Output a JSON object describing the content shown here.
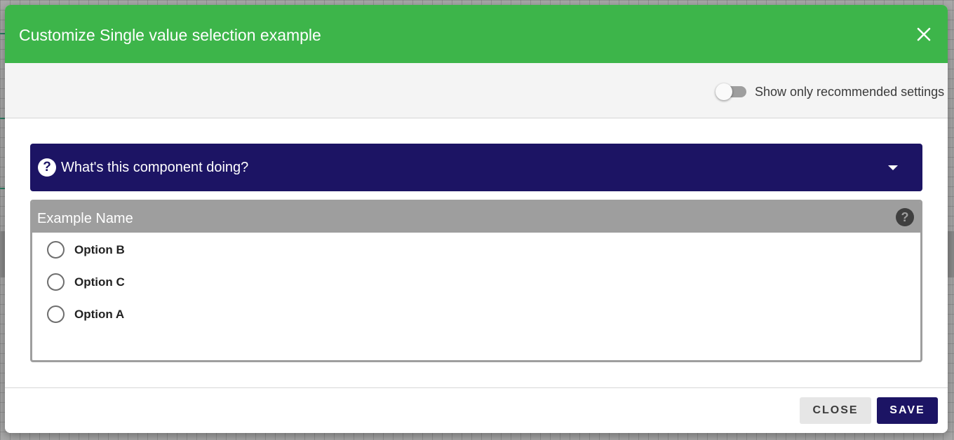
{
  "modal": {
    "title": "Customize Single value selection example"
  },
  "settings": {
    "toggle_label": "Show only recommended settings",
    "toggle_on": false
  },
  "help_panel": {
    "title": "What's this component doing?",
    "icon_glyph": "?"
  },
  "field": {
    "label": "Example Name",
    "help_glyph": "?",
    "options": [
      {
        "label": "Option B",
        "selected": false
      },
      {
        "label": "Option C",
        "selected": false
      },
      {
        "label": "Option A",
        "selected": false
      }
    ]
  },
  "footer": {
    "close_label": "CLOSE",
    "save_label": "SAVE"
  },
  "colors": {
    "header_green": "#3db54a",
    "primary_navy": "#1c1464",
    "field_gray": "#9e9e9e",
    "settings_bg": "#f4f4f4"
  },
  "icons": {
    "close": "close-icon",
    "help": "question-circle-icon",
    "expand": "caret-down-icon"
  }
}
